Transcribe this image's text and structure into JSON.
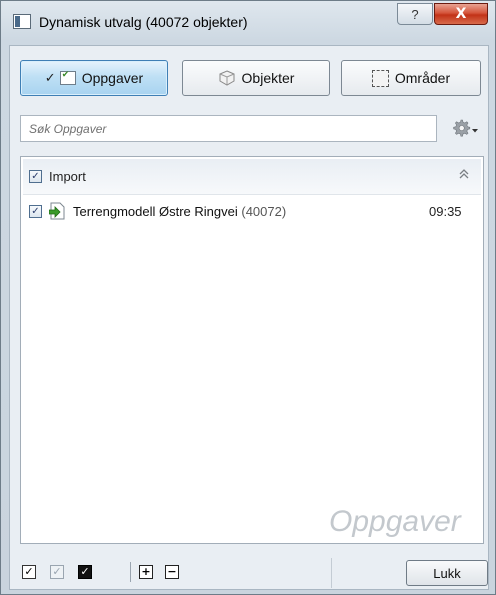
{
  "window": {
    "title": "Dynamisk utvalg (40072 objekter)",
    "help_label": "?",
    "close_label": "X"
  },
  "tabs": {
    "oppgaver": {
      "label": "Oppgaver",
      "active": true,
      "check": "✓"
    },
    "objekter": {
      "label": "Objekter",
      "active": false
    },
    "omrader": {
      "label": "Områder",
      "active": false
    }
  },
  "search": {
    "placeholder": "Søk Oppgaver",
    "value": ""
  },
  "group": {
    "label": "Import",
    "checked": true,
    "check": "✓",
    "collapse_icon": "chevron-double-up-icon",
    "collapse_glyph": "⌃"
  },
  "rows": [
    {
      "name": "Terrengmodell Østre Ringvei",
      "count": "(40072)",
      "time": "09:35",
      "checked": true,
      "check": "✓",
      "icon": "import-arrow-icon"
    }
  ],
  "watermark": "Oppgaver",
  "bottom_toolbar": {
    "select_all_glyph": "✓",
    "select_gray_glyph": "✓",
    "select_filled_glyph": "✓",
    "expand_glyph": "+",
    "collapse_glyph": "−",
    "close_label": "Lukk"
  },
  "colors": {
    "active_tab": "#a8d3f0",
    "close_button": "#c23217",
    "import_icon_green": "#3a9a2a"
  }
}
